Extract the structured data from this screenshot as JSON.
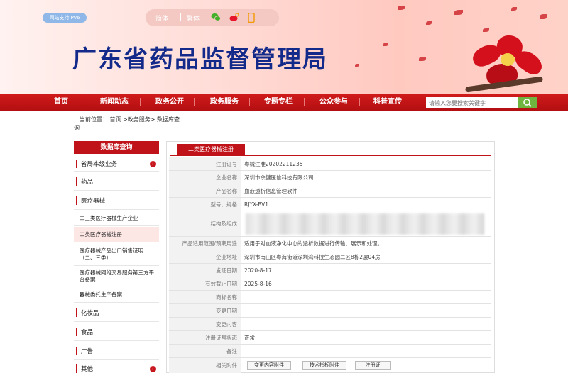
{
  "banner": {
    "ipv6_badge": "网站支持IPv6",
    "lang_simplified": "简体",
    "lang_traditional": "繁体",
    "site_title": "广东省药品监督管理局"
  },
  "nav": {
    "items": [
      "首页",
      "新闻动态",
      "政务公开",
      "政务服务",
      "专题专栏",
      "公众参与",
      "科普宣传"
    ],
    "search_placeholder": "请输入您要搜索关键字"
  },
  "breadcrumb": {
    "prefix": "当前位置：",
    "path": "首页  >政务服务>  数据库查",
    "wrap": "询"
  },
  "sidebar": {
    "header": "数据库查询",
    "items": [
      {
        "label": "省局本级业务",
        "kind": "main",
        "arrow": true
      },
      {
        "label": "药品",
        "kind": "main",
        "arrow": false
      },
      {
        "label": "医疗器械",
        "kind": "main",
        "arrow": false
      },
      {
        "label": "二三类医疗器械生产企业",
        "kind": "sub",
        "arrow": false
      },
      {
        "label": "二类医疗器械注册",
        "kind": "sub",
        "active": true
      },
      {
        "label": "医疗器械产品出口销售证明（二、三类）",
        "kind": "sub"
      },
      {
        "label": "医疗器械网络交易服务第三方平台备案",
        "kind": "sub"
      },
      {
        "label": "器械委托生产备案",
        "kind": "sub"
      },
      {
        "label": "化妆品",
        "kind": "main"
      },
      {
        "label": "食品",
        "kind": "main"
      },
      {
        "label": "广告",
        "kind": "main"
      },
      {
        "label": "其他",
        "kind": "main",
        "arrow": true
      }
    ]
  },
  "detail": {
    "tab_label": "二类医疗器械注册",
    "rows": [
      {
        "label": "注册证号",
        "value": "粤械注准20202211235"
      },
      {
        "label": "企业名称",
        "value": "深圳市余健医信科技有限公司"
      },
      {
        "label": "产品名称",
        "value": "血液透析信息管理软件"
      },
      {
        "label": "型号、规格",
        "value": "RJYX-BV1"
      },
      {
        "label": "结构及组成",
        "value": ""
      },
      {
        "label": "产品适用范围/预期用途",
        "value": "适用于对血液净化中心的透析数据进行传输、展示和处理。"
      },
      {
        "label": "企业地址",
        "value": "深圳市南山区粤海街道深圳湾科技生态园二区8栋2层04房"
      },
      {
        "label": "发证日期",
        "value": "2020-8-17"
      },
      {
        "label": "有效截止日期",
        "value": "2025-8-16"
      },
      {
        "label": "商标名称",
        "value": ""
      },
      {
        "label": "变更日期",
        "value": ""
      },
      {
        "label": "变更内容",
        "value": ""
      },
      {
        "label": "注册证号状态",
        "value": "正常"
      },
      {
        "label": "备注",
        "value": ""
      },
      {
        "label": "相关附件",
        "value": ""
      }
    ],
    "attachments": [
      "变更内容附件",
      "技术指标附件",
      "注册证"
    ]
  },
  "colors": {
    "brand_red": "#c01219",
    "title_blue": "#132a8a",
    "search_green": "#6fb43f"
  }
}
